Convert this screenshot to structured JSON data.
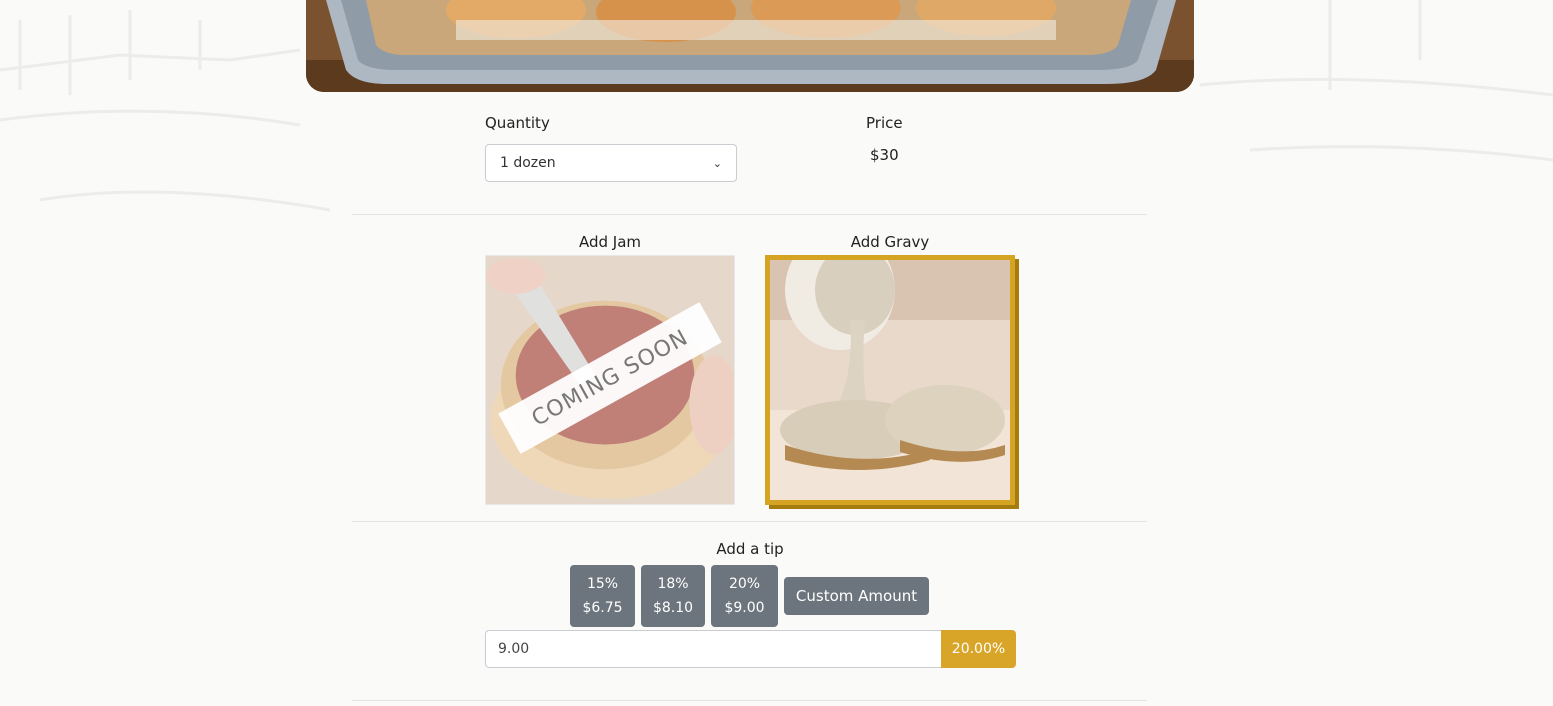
{
  "quantity": {
    "label": "Quantity",
    "selected": "1 dozen"
  },
  "price": {
    "label": "Price",
    "value": "$30"
  },
  "addons": {
    "jam": {
      "title": "Add Jam",
      "badge": "COMING SOON"
    },
    "gravy": {
      "title": "Add Gravy"
    }
  },
  "tip": {
    "title": "Add a tip",
    "options": [
      {
        "percent": "15%",
        "amount": "$6.75"
      },
      {
        "percent": "18%",
        "amount": "$8.10"
      },
      {
        "percent": "20%",
        "amount": "$9.00"
      }
    ],
    "custom_label": "Custom Amount",
    "input_value": "9.00",
    "percent_display": "20.00%"
  },
  "colors": {
    "accent_gold": "#d9a528",
    "button_gray": "#6c757d"
  }
}
